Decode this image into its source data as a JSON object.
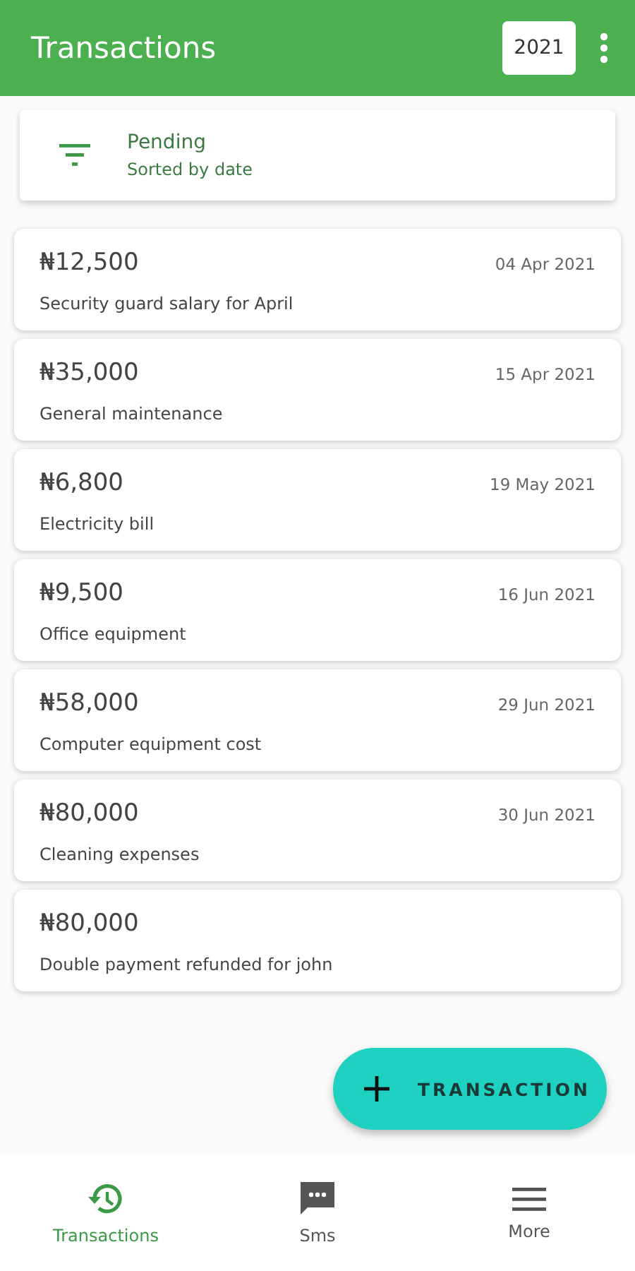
{
  "app_bar": {
    "title": "Transactions",
    "year": "2021"
  },
  "filter": {
    "title": "Pending",
    "subtitle": "Sorted by date"
  },
  "transactions": [
    {
      "amount": "₦12,500",
      "date": "04 Apr 2021",
      "description": "Security guard salary for April"
    },
    {
      "amount": "₦35,000",
      "date": "15 Apr 2021",
      "description": "General maintenance"
    },
    {
      "amount": "₦6,800",
      "date": "19 May 2021",
      "description": "Electricity bill"
    },
    {
      "amount": "₦9,500",
      "date": "16 Jun 2021",
      "description": "Office equipment"
    },
    {
      "amount": "₦58,000",
      "date": "29 Jun 2021",
      "description": "Computer equipment cost"
    },
    {
      "amount": "₦80,000",
      "date": "30 Jun 2021",
      "description": "Cleaning expenses"
    },
    {
      "amount": "₦80,000",
      "description": "Double payment refunded for john"
    }
  ],
  "fab": {
    "label": "TRANSACTION"
  },
  "bottom_nav": [
    {
      "kind": "history",
      "label": "Transactions",
      "selected": true
    },
    {
      "kind": "sms",
      "label": "Sms",
      "selected": false
    },
    {
      "kind": "more",
      "label": "More",
      "selected": false
    }
  ]
}
